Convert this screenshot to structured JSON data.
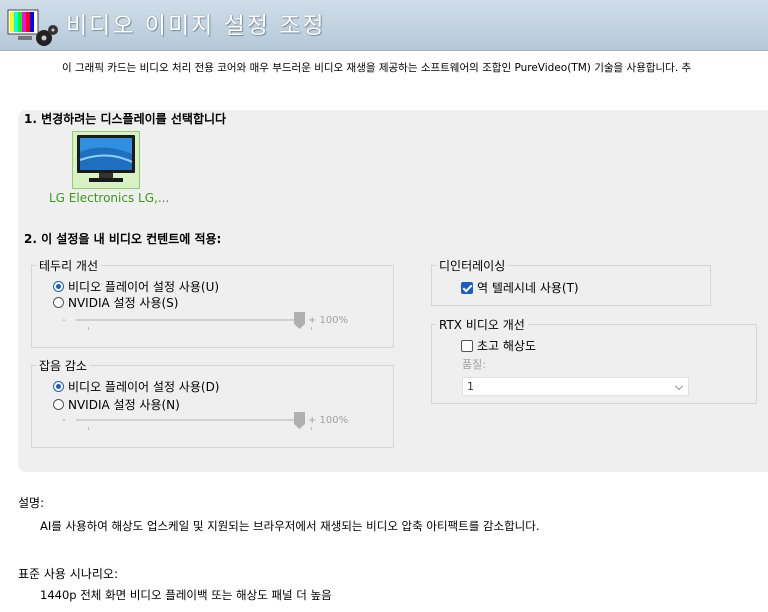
{
  "header": {
    "title": "비디오 이미지 설정 조정",
    "icon": "video-settings-icon"
  },
  "intro": "이 그래픽 카드는 비디오 처리 전용 코어와 매우 부드러운 비디오 재생을 제공하는 소프트웨어의 조합인 PureVideo(TM) 기술을 사용합니다. 추",
  "step1": {
    "title": "1. 변경하려는 디스플레이를 선택합니다",
    "display_label": "LG Electronics LG,..."
  },
  "step2": {
    "title": "2. 이 설정을 내 비디오 컨텐트에 적용:"
  },
  "edge": {
    "legend": "테두리 개선",
    "option_player": "비디오 플레이어 설정 사용(U)",
    "option_nvidia": "NVIDIA 설정 사용(S)",
    "selected": "player",
    "slider_minus": "-",
    "slider_value": "+ 100%",
    "level": 1.0
  },
  "noise": {
    "legend": "잡음 감소",
    "option_player": "비디오 플레이어 설정 사용(D)",
    "option_nvidia": "NVIDIA 설정 사용(N)",
    "selected": "player",
    "slider_minus": "-",
    "slider_value": "+ 100%",
    "level": 1.0
  },
  "deinterlace": {
    "legend": "디인터레이싱",
    "option": "역 텔레시네 사용(T)",
    "checked": true
  },
  "rtx": {
    "legend": "RTX 비디오 개선",
    "option": "초고 해상도",
    "checked": false,
    "quality_label": "품질:",
    "quality_value": "1"
  },
  "description": {
    "label": "설명:",
    "text": "AI를 사용하여 해상도 업스케일 및 지원되는 브라우저에서 재생되는 비디오 압축 아티팩트를 감소합니다."
  },
  "scenario": {
    "label": "표준 사용 시나리오:",
    "text": "1440p 전체 화면 비디오 플레이백 또는 해상도 패널 더 높음"
  },
  "colors": {
    "accent": "#1a5fc9",
    "selection_green": "#3a9a1a",
    "panel_bg": "#efefef",
    "header_bg": "#c4d4e2"
  }
}
